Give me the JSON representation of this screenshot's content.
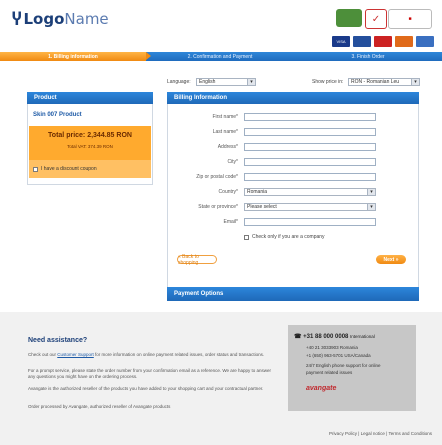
{
  "header": {
    "logo_bold": "Logo",
    "logo_light": "Name",
    "badges": [
      "",
      "",
      ""
    ],
    "cards": [
      "VISA",
      "",
      "",
      "",
      ""
    ]
  },
  "steps": [
    {
      "label": "1. Billing information",
      "active": true
    },
    {
      "label": "2. Confirmation and Payment",
      "active": false
    },
    {
      "label": "3. Finish Order",
      "active": false
    }
  ],
  "language": {
    "label": "Language:",
    "value": "English"
  },
  "currency": {
    "label": "Show price in:",
    "value": "RON - Romanian Leu"
  },
  "product": {
    "heading": "Product",
    "name": "Skin 007 Product",
    "total_price": "Total price: 2,344.85 RON",
    "vat_note": "Total VAT: 374.39 RON",
    "coupon_label": "I have a discount coupon"
  },
  "billing": {
    "heading": "Billing Information",
    "fields": [
      {
        "label": "First name*",
        "value": ""
      },
      {
        "label": "Last name*",
        "value": ""
      },
      {
        "label": "Address*",
        "value": ""
      },
      {
        "label": "City*",
        "value": ""
      },
      {
        "label": "Zip or postal code*",
        "value": ""
      },
      {
        "label": "Country*",
        "value": "Romania"
      },
      {
        "label": "State or province*",
        "value": "Please select"
      },
      {
        "label": "Email*",
        "value": ""
      }
    ],
    "company_check": "Check only if you are a company",
    "back_button": "« Back to shopping",
    "next_button": "Next »"
  },
  "payment": {
    "heading": "Payment Options"
  },
  "footer": {
    "assist_title": "Need assistance?",
    "para1_a": "Check out our ",
    "para1_link": "Customer Support",
    "para1_b": " for more information on online payment related issues, order status and transactions.",
    "para2": "For a prompt service, please state the order number from your confirmation email as a reference. We are happy to answer any questions you might have on the ordering process.",
    "para3": "Avangate is the authorized reseller of the products you have added to your shopping cart and your contractual partner.",
    "para4": "Order processed by Avangate, authorized reseller of Avangate products",
    "contact_phone": "+31 88 000 0008",
    "contact_phone_suffix": "International",
    "contact_lines": [
      "+40 21 3033903 Romania",
      "+1 (650) 963-5701 USA/Canada",
      "24/7 English phone support for online",
      "payment related issues"
    ],
    "contact_brand": "avangate",
    "links": "Privacy Policy | Legal notice | Terms and Conditions"
  },
  "colors": {
    "accent_blue": "#1f6bbd",
    "accent_orange": "#f08a12",
    "total_bg": "#ffaa2e"
  }
}
